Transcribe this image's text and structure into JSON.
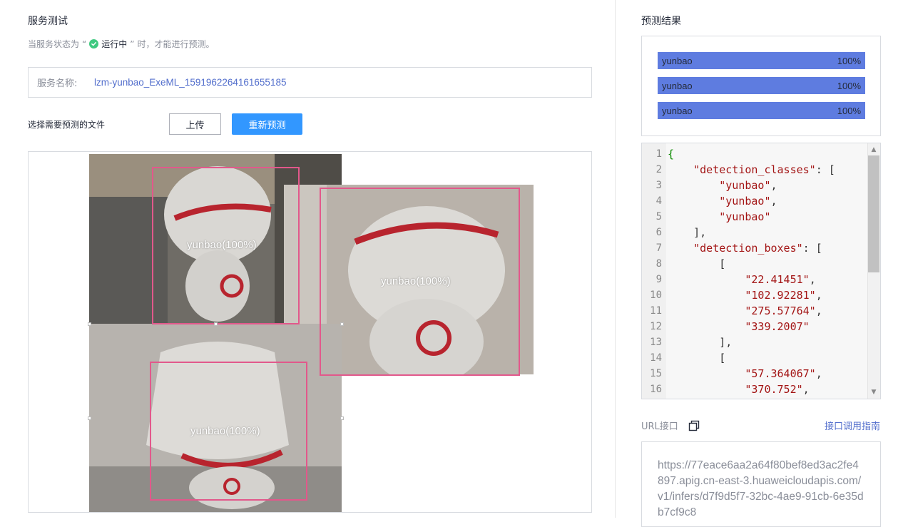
{
  "service_test": {
    "title": "服务测试",
    "status_prefix": "当服务状态为",
    "quote_open": "“",
    "status_running": "运行中",
    "quote_close": "”",
    "status_suffix": "时，才能进行预测。",
    "service_name_label": "服务名称:",
    "service_name_value": "lzm-yunbao_ExeML_1591962264161655185",
    "choose_file_label": "选择需要预测的文件",
    "upload_button": "上传",
    "repredict_button": "重新预测"
  },
  "detections_overlay": [
    {
      "label": "yunbao(100%)"
    },
    {
      "label": "yunbao(100%)"
    },
    {
      "label": "yunbao(100%)"
    }
  ],
  "prediction_result": {
    "title": "预测结果",
    "items": [
      {
        "label": "yunbao",
        "score": "100%",
        "fraction": 1.0
      },
      {
        "label": "yunbao",
        "score": "100%",
        "fraction": 1.0
      },
      {
        "label": "yunbao",
        "score": "100%",
        "fraction": 1.0
      }
    ],
    "bar_color": "#5e7ce0"
  },
  "code_view": {
    "lines": [
      {
        "n": "1",
        "indent": "",
        "tokens": [
          {
            "t": "{",
            "c": "brace"
          }
        ]
      },
      {
        "n": "2",
        "indent": "    ",
        "tokens": [
          {
            "t": "\"detection_classes\"",
            "c": "key"
          },
          {
            "t": ": [",
            "c": "plain"
          }
        ]
      },
      {
        "n": "3",
        "indent": "        ",
        "tokens": [
          {
            "t": "\"yunbao\"",
            "c": "str"
          },
          {
            "t": ",",
            "c": "plain"
          }
        ]
      },
      {
        "n": "4",
        "indent": "        ",
        "tokens": [
          {
            "t": "\"yunbao\"",
            "c": "str"
          },
          {
            "t": ",",
            "c": "plain"
          }
        ]
      },
      {
        "n": "5",
        "indent": "        ",
        "tokens": [
          {
            "t": "\"yunbao\"",
            "c": "str"
          }
        ]
      },
      {
        "n": "6",
        "indent": "    ",
        "tokens": [
          {
            "t": "],",
            "c": "plain"
          }
        ]
      },
      {
        "n": "7",
        "indent": "    ",
        "tokens": [
          {
            "t": "\"detection_boxes\"",
            "c": "key"
          },
          {
            "t": ": [",
            "c": "plain"
          }
        ]
      },
      {
        "n": "8",
        "indent": "        ",
        "tokens": [
          {
            "t": "[",
            "c": "plain"
          }
        ]
      },
      {
        "n": "9",
        "indent": "            ",
        "tokens": [
          {
            "t": "\"22.41451\"",
            "c": "str"
          },
          {
            "t": ",",
            "c": "plain"
          }
        ]
      },
      {
        "n": "10",
        "indent": "            ",
        "tokens": [
          {
            "t": "\"102.92281\"",
            "c": "str"
          },
          {
            "t": ",",
            "c": "plain"
          }
        ]
      },
      {
        "n": "11",
        "indent": "            ",
        "tokens": [
          {
            "t": "\"275.57764\"",
            "c": "str"
          },
          {
            "t": ",",
            "c": "plain"
          }
        ]
      },
      {
        "n": "12",
        "indent": "            ",
        "tokens": [
          {
            "t": "\"339.2007\"",
            "c": "str"
          }
        ]
      },
      {
        "n": "13",
        "indent": "        ",
        "tokens": [
          {
            "t": "],",
            "c": "plain"
          }
        ]
      },
      {
        "n": "14",
        "indent": "        ",
        "tokens": [
          {
            "t": "[",
            "c": "plain"
          }
        ]
      },
      {
        "n": "15",
        "indent": "            ",
        "tokens": [
          {
            "t": "\"57.364067\"",
            "c": "str"
          },
          {
            "t": ",",
            "c": "plain"
          }
        ]
      },
      {
        "n": "16",
        "indent": "            ",
        "tokens": [
          {
            "t": "\"370.752\"",
            "c": "str"
          },
          {
            "t": ",",
            "c": "plain"
          }
        ]
      }
    ]
  },
  "url_section": {
    "label": "URL接口",
    "copy_icon": "copy-icon",
    "guide_link": "接口调用指南",
    "url": "https://77eace6aa2a64f80bef8ed3ac2fe4897.apig.cn-east-3.huaweicloudapis.com/v1/infers/d7f9d5f7-32bc-4ae9-91cb-6e35db7cf9c8"
  },
  "colors": {
    "accent": "#3297ff",
    "link": "#526ecc",
    "bbox": "#e2588b",
    "status_ok": "#3fc980"
  }
}
